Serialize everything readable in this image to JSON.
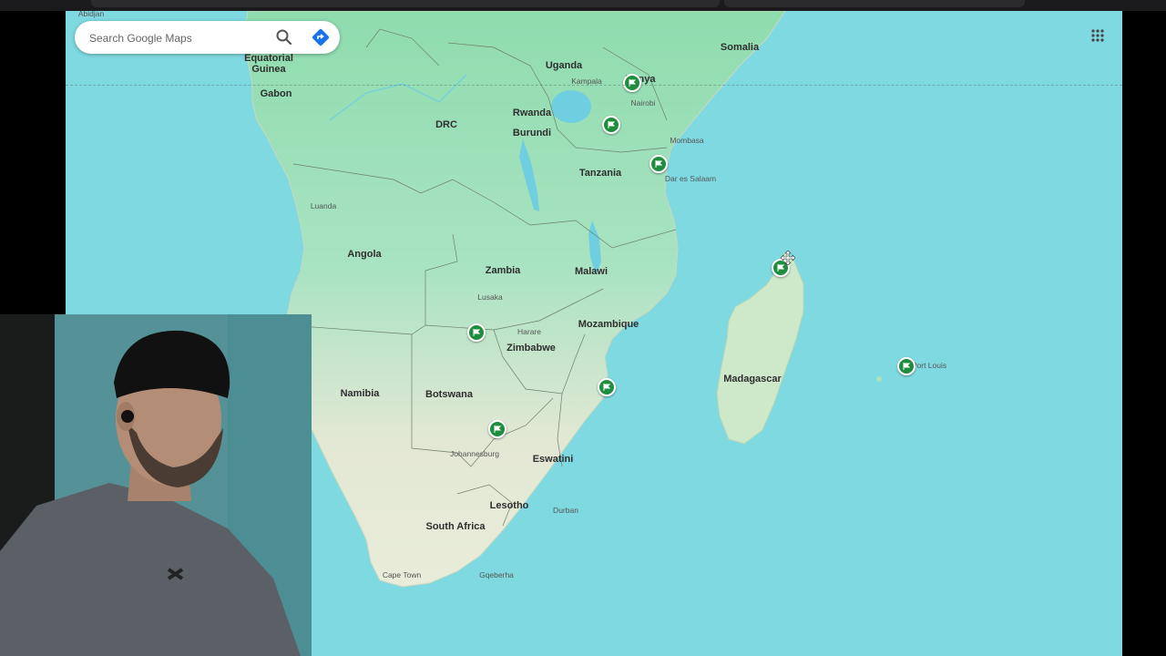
{
  "search": {
    "placeholder": "Search Google Maps"
  },
  "countries": [
    {
      "id": "equatorial-guinea",
      "label": "Equatorial\nGuinea"
    },
    {
      "id": "gabon",
      "label": "Gabon"
    },
    {
      "id": "drc",
      "label": "DRC"
    },
    {
      "id": "uganda",
      "label": "Uganda"
    },
    {
      "id": "kenya",
      "label": "Kenya"
    },
    {
      "id": "somalia",
      "label": "Somalia"
    },
    {
      "id": "rwanda",
      "label": "Rwanda"
    },
    {
      "id": "burundi",
      "label": "Burundi"
    },
    {
      "id": "tanzania",
      "label": "Tanzania"
    },
    {
      "id": "angola",
      "label": "Angola"
    },
    {
      "id": "zambia",
      "label": "Zambia"
    },
    {
      "id": "malawi",
      "label": "Malawi"
    },
    {
      "id": "mozambique",
      "label": "Mozambique"
    },
    {
      "id": "zimbabwe",
      "label": "Zimbabwe"
    },
    {
      "id": "namibia",
      "label": "Namibia"
    },
    {
      "id": "botswana",
      "label": "Botswana"
    },
    {
      "id": "madagascar",
      "label": "Madagascar"
    },
    {
      "id": "eswatini",
      "label": "Eswatini"
    },
    {
      "id": "lesotho",
      "label": "Lesotho"
    },
    {
      "id": "south-africa",
      "label": "South Africa"
    }
  ],
  "cities": [
    {
      "id": "abidjan",
      "label": "Abidjan"
    },
    {
      "id": "kampala",
      "label": "Kampala"
    },
    {
      "id": "nairobi",
      "label": "Nairobi"
    },
    {
      "id": "mombasa",
      "label": "Mombasa"
    },
    {
      "id": "dar-es-salaam",
      "label": "Dar es Salaam"
    },
    {
      "id": "luanda",
      "label": "Luanda"
    },
    {
      "id": "lusaka",
      "label": "Lusaka"
    },
    {
      "id": "harare",
      "label": "Harare"
    },
    {
      "id": "port-louis",
      "label": "Port Louis"
    },
    {
      "id": "johannesburg",
      "label": "Johannesburg"
    },
    {
      "id": "durban",
      "label": "Durban"
    },
    {
      "id": "cape-town",
      "label": "Cape Town"
    },
    {
      "id": "gqeberha",
      "label": "Gqeberha"
    }
  ],
  "pins_icon": "green-flag-pin-icon",
  "colors": {
    "water": "#7fd9e0",
    "land": "#a9e3c2",
    "desert": "#e6e8d2",
    "pin": "#1e8e3e"
  }
}
